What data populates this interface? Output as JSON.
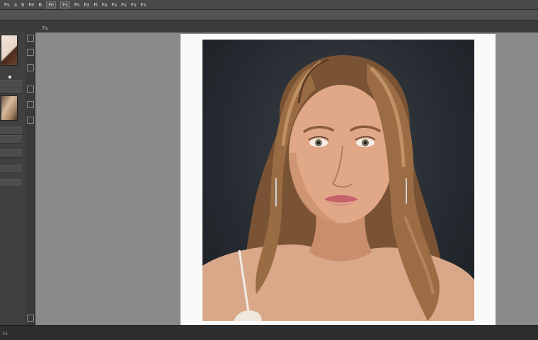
{
  "menubar": {
    "items": [
      "Fs",
      "a",
      "6",
      "Fe",
      "B",
      "Ps",
      "Fa",
      "Fi",
      "Fa",
      "Fs",
      "Fs",
      "Fs",
      "Fs"
    ],
    "boxed": [
      "Fe",
      "Fs"
    ]
  },
  "document": {
    "tab_label": "Fs"
  },
  "status": {
    "text": "Fs"
  },
  "colors": {
    "menubar": "#4a4a4a",
    "canvas": "#8a8a8a",
    "paper": "#fafafa",
    "photo_background": "#262b31"
  },
  "icons": [
    "hand-icon",
    "zoom-icon",
    "brush-icon",
    "lasso-icon",
    "crop-icon",
    "eyedropper-icon",
    "type-icon"
  ]
}
